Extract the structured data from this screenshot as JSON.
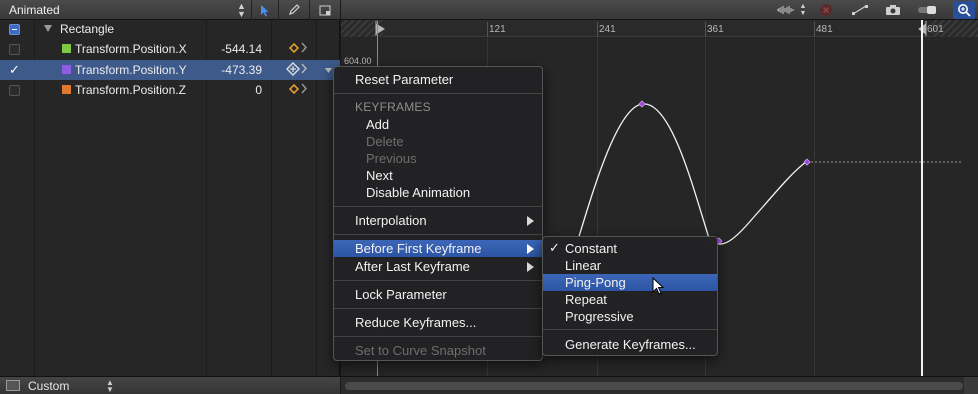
{
  "colors": {
    "selection_row": "#3d5a8a",
    "menu_highlight": "#2f58a8",
    "keyframe_diamond": "#e09a30",
    "curve_point": "#a040e0",
    "pos_x_swatch": "#7ec843",
    "pos_y_swatch": "#8e5ce0",
    "pos_z_swatch": "#e0782e"
  },
  "left_panel": {
    "header_title": "Animated",
    "group": {
      "name": "Rectangle"
    },
    "params": [
      {
        "name": "Transform.Position.X",
        "value": "-544.14",
        "checked": false,
        "selected": false
      },
      {
        "name": "Transform.Position.Y",
        "value": "-473.39",
        "checked": true,
        "selected": true
      },
      {
        "name": "Transform.Position.Z",
        "value": "0",
        "checked": false,
        "selected": false
      }
    ],
    "footer_preset": "Custom"
  },
  "graph": {
    "ruler_ticks": [
      "121",
      "241",
      "361",
      "481",
      "601"
    ],
    "y_max_label": "604.00"
  },
  "context_menu": {
    "reset": "Reset Parameter",
    "keyframes_header": "KEYFRAMES",
    "add": "Add",
    "delete": "Delete",
    "previous": "Previous",
    "next": "Next",
    "disable_animation": "Disable Animation",
    "interpolation": "Interpolation",
    "before_first": "Before First Keyframe",
    "after_last": "After Last Keyframe",
    "lock": "Lock Parameter",
    "reduce": "Reduce Keyframes...",
    "snapshot": "Set to Curve Snapshot"
  },
  "submenu": {
    "constant": "Constant",
    "linear": "Linear",
    "ping_pong": "Ping-Pong",
    "repeat": "Repeat",
    "progressive": "Progressive",
    "generate": "Generate Keyframes..."
  },
  "icons": {
    "toolbar": [
      "pointer-icon",
      "pen-icon",
      "layout-icon",
      "audio-waveform-icon",
      "stop-icon",
      "fit-curve-icon",
      "snapshot-camera-icon",
      "toggle-icon",
      "zoom-icon"
    ]
  }
}
